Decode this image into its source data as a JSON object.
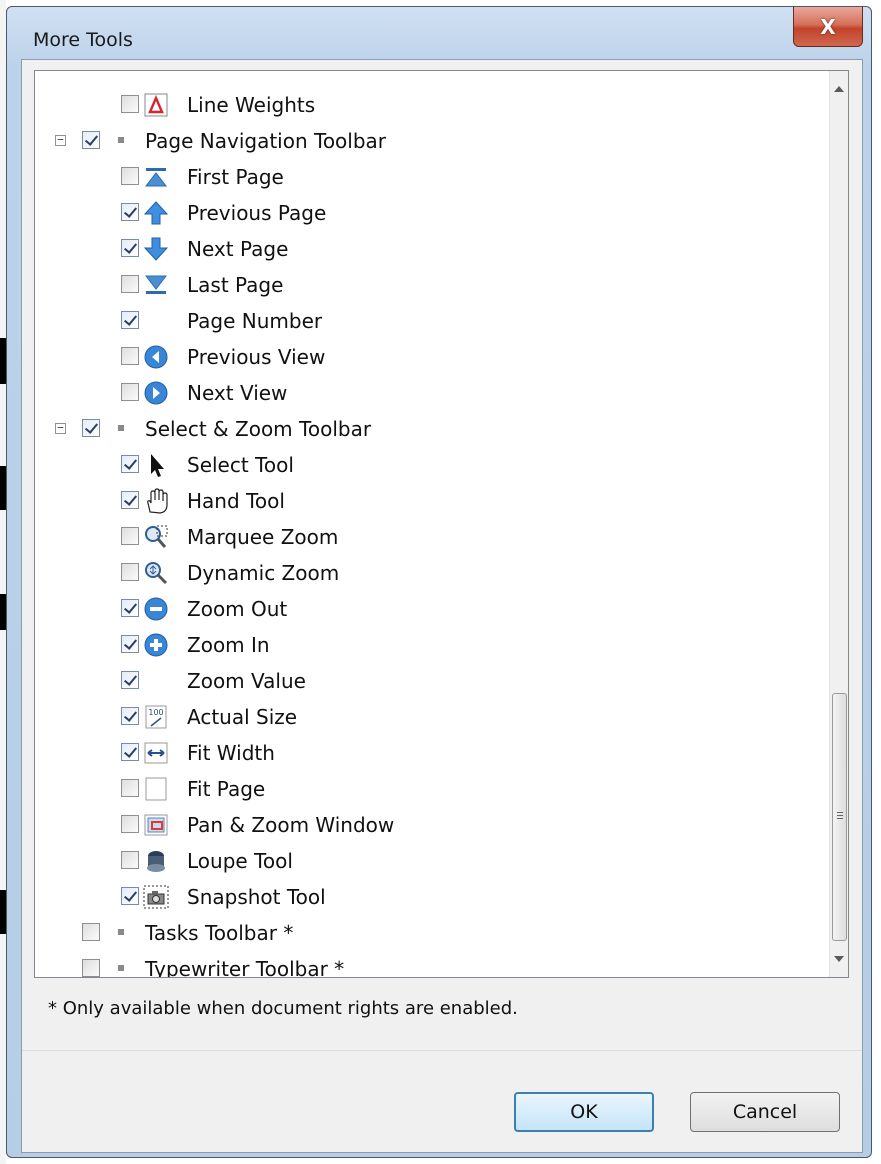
{
  "window": {
    "title": "More Tools",
    "close_label": "X"
  },
  "tree": {
    "items": [
      {
        "label": "Line Weights",
        "checked": false,
        "icon": "line-weights-icon",
        "level": 2
      },
      {
        "label": "Page Navigation Toolbar",
        "checked": true,
        "level": 1,
        "expanded": true
      },
      {
        "label": "First Page",
        "checked": false,
        "icon": "first-page-icon",
        "level": 2
      },
      {
        "label": "Previous Page",
        "checked": true,
        "icon": "previous-page-icon",
        "level": 2
      },
      {
        "label": "Next Page",
        "checked": true,
        "icon": "next-page-icon",
        "level": 2
      },
      {
        "label": "Last Page",
        "checked": false,
        "icon": "last-page-icon",
        "level": 2
      },
      {
        "label": "Page Number",
        "checked": true,
        "level": 2
      },
      {
        "label": "Previous View",
        "checked": false,
        "icon": "previous-view-icon",
        "level": 2
      },
      {
        "label": "Next View",
        "checked": false,
        "icon": "next-view-icon",
        "level": 2
      },
      {
        "label": "Select & Zoom Toolbar",
        "checked": true,
        "level": 1,
        "expanded": true
      },
      {
        "label": "Select Tool",
        "checked": true,
        "icon": "select-arrow-icon",
        "level": 2
      },
      {
        "label": "Hand Tool",
        "checked": true,
        "icon": "hand-icon",
        "level": 2
      },
      {
        "label": "Marquee Zoom",
        "checked": false,
        "icon": "marquee-zoom-icon",
        "level": 2
      },
      {
        "label": "Dynamic Zoom",
        "checked": false,
        "icon": "dynamic-zoom-icon",
        "level": 2
      },
      {
        "label": "Zoom Out",
        "checked": true,
        "icon": "zoom-out-icon",
        "level": 2
      },
      {
        "label": "Zoom In",
        "checked": true,
        "icon": "zoom-in-icon",
        "level": 2
      },
      {
        "label": "Zoom Value",
        "checked": true,
        "level": 2
      },
      {
        "label": "Actual Size",
        "checked": true,
        "icon": "actual-size-icon",
        "level": 2
      },
      {
        "label": "Fit Width",
        "checked": true,
        "icon": "fit-width-icon",
        "level": 2
      },
      {
        "label": "Fit Page",
        "checked": false,
        "icon": "fit-page-icon",
        "level": 2
      },
      {
        "label": "Pan & Zoom Window",
        "checked": false,
        "icon": "pan-zoom-window-icon",
        "level": 2
      },
      {
        "label": "Loupe Tool",
        "checked": false,
        "icon": "loupe-icon",
        "level": 2
      },
      {
        "label": "Snapshot Tool",
        "checked": true,
        "icon": "snapshot-camera-icon",
        "level": 2
      },
      {
        "label": "Tasks Toolbar *",
        "checked": false,
        "level": 1,
        "expanded": null
      },
      {
        "label": "Typewriter Toolbar *",
        "checked": false,
        "level": 1,
        "expanded": null
      }
    ]
  },
  "actual_size_icon_text": "100",
  "note": "* Only available when document rights are enabled.",
  "buttons": {
    "ok": "OK",
    "cancel": "Cancel"
  },
  "scrollbar": {
    "position_fraction": 0.68,
    "visible_fraction": 0.27
  }
}
